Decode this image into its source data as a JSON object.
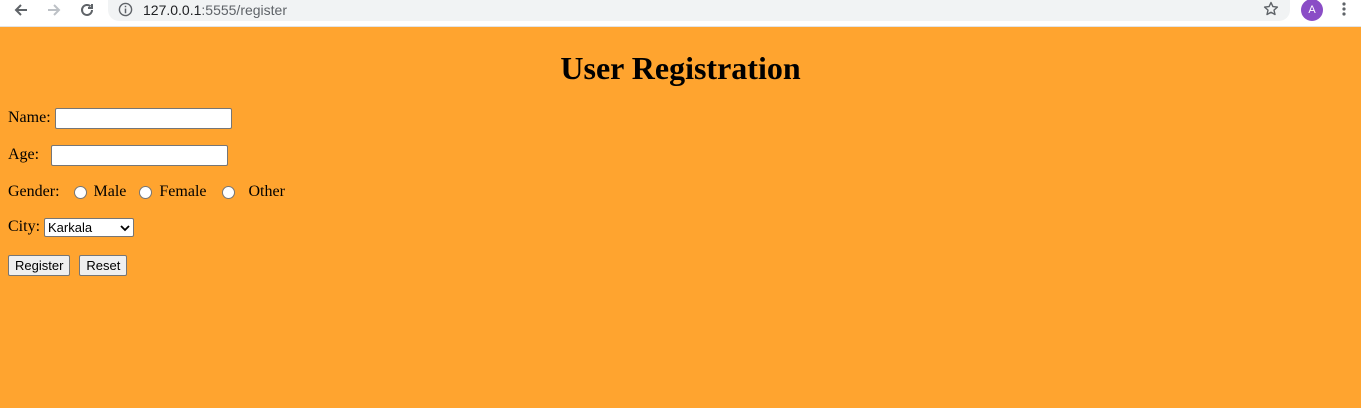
{
  "browser": {
    "url_host": "127.0.0.1",
    "url_path": ":5555/register",
    "avatar_letter": "A",
    "icons": [
      "back-arrow-icon",
      "forward-arrow-icon",
      "reload-icon",
      "site-info-icon",
      "bookmark-star-icon",
      "kebab-menu-icon"
    ]
  },
  "page": {
    "title": "User Registration",
    "background_color": "#ffa42f",
    "name_label": "Name:",
    "name_value": "",
    "age_label": "Age:",
    "age_value": "",
    "gender_label": "Gender:",
    "gender_options": [
      "Male",
      "Female",
      "Other"
    ],
    "city_label": "City:",
    "city_selected": "Karkala",
    "register_button": "Register",
    "reset_button": "Reset"
  },
  "colors": {
    "avatar": "#8a4dc6",
    "page_bg": "#ffa42f"
  }
}
